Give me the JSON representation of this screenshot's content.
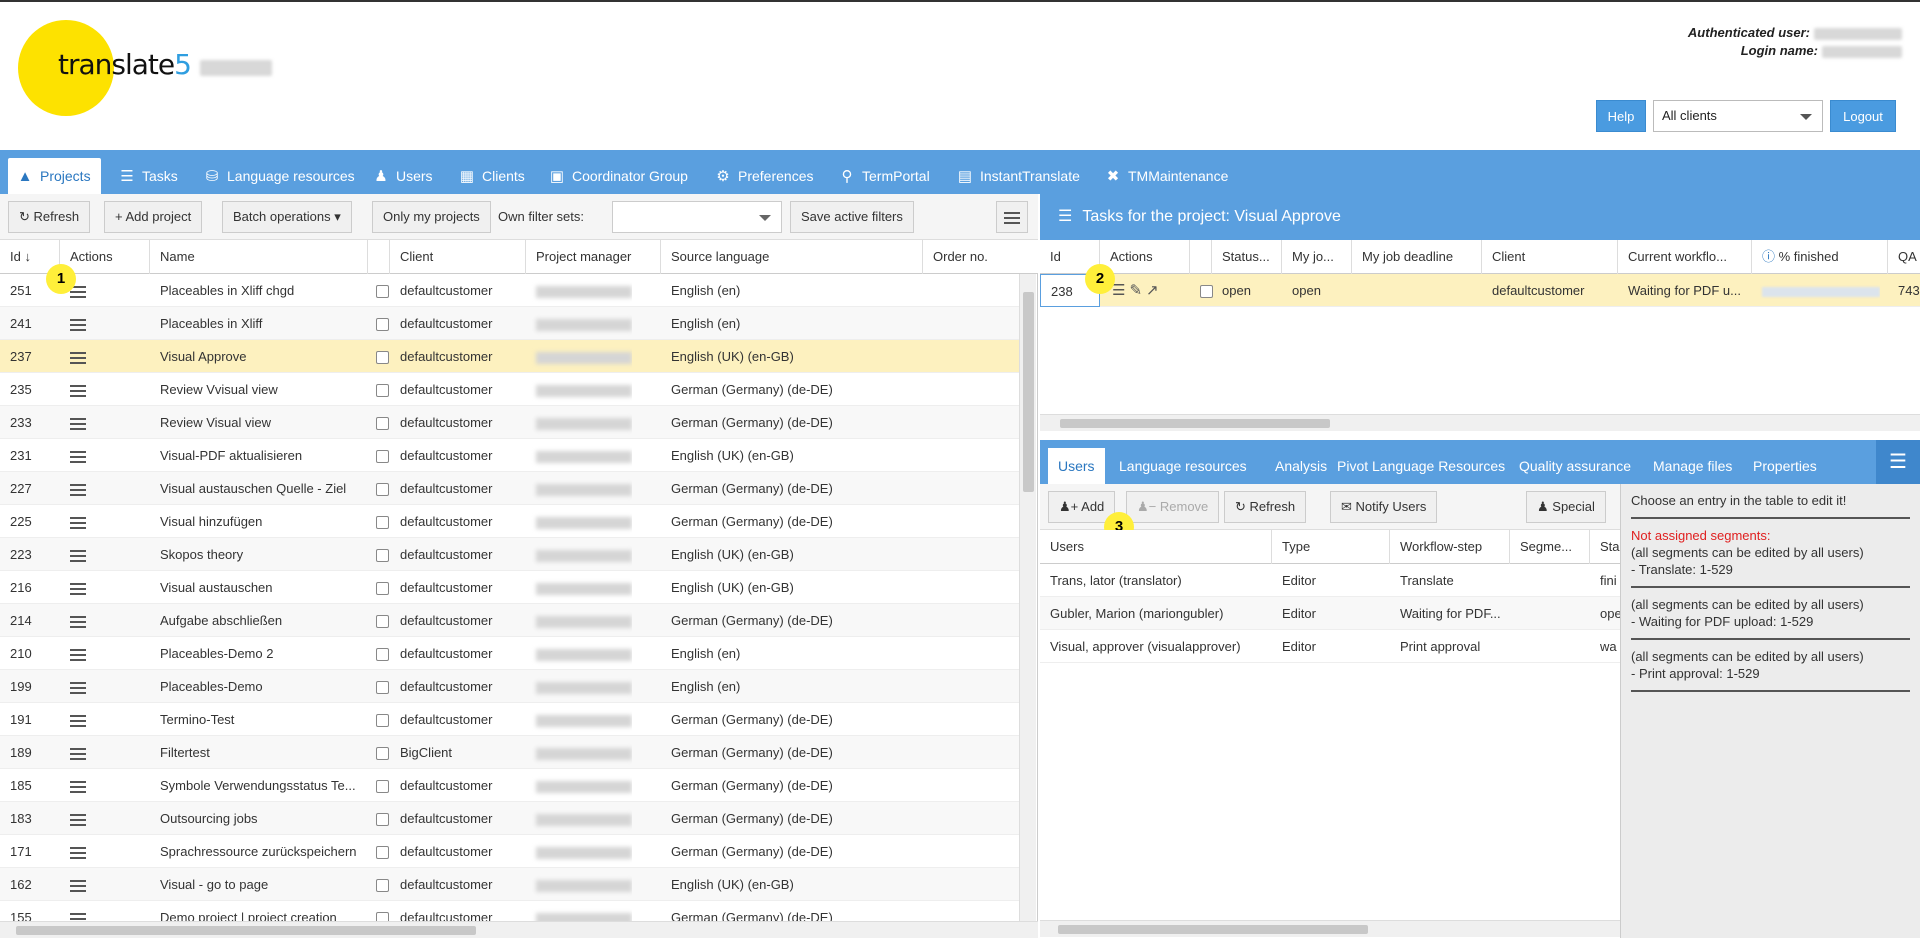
{
  "app": {
    "logo_text": "translate",
    "logo_five": "5"
  },
  "header": {
    "auth_user_label": "Authenticated user:",
    "login_name_label": "Login name:",
    "help_label": "Help",
    "client_select_value": "All clients",
    "logout_label": "Logout"
  },
  "nav": {
    "tabs": [
      {
        "label": "Projects",
        "icon": "sitemap-icon"
      },
      {
        "label": "Tasks",
        "icon": "list-icon"
      },
      {
        "label": "Language resources",
        "icon": "database-icon"
      },
      {
        "label": "Users",
        "icon": "users-icon"
      },
      {
        "label": "Clients",
        "icon": "building-icon"
      },
      {
        "label": "Coordinator Group",
        "icon": "id-badge-icon"
      },
      {
        "label": "Preferences",
        "icon": "gears-icon"
      },
      {
        "label": "TermPortal",
        "icon": "search-icon"
      },
      {
        "label": "InstantTranslate",
        "icon": "translate-icon"
      },
      {
        "label": "TMMaintenance",
        "icon": "tools-icon"
      }
    ]
  },
  "projects": {
    "toolbar": {
      "refresh": "Refresh",
      "add_project": "Add project",
      "batch_operations": "Batch operations",
      "only_my_projects": "Only my projects",
      "own_filter_sets": "Own filter sets:",
      "save_active_filters": "Save active filters"
    },
    "columns": [
      "Id",
      "Actions",
      "Name",
      "",
      "Client",
      "Project manager",
      "Source language",
      "Order no."
    ],
    "rows": [
      {
        "id": "251",
        "name": "Placeables in Xliff chgd",
        "client": "defaultcustomer",
        "lang": "English (en)"
      },
      {
        "id": "241",
        "name": "Placeables in Xliff",
        "client": "defaultcustomer",
        "lang": "English (en)"
      },
      {
        "id": "237",
        "name": "Visual Approve",
        "client": "defaultcustomer",
        "lang": "English (UK) (en-GB)"
      },
      {
        "id": "235",
        "name": "Review Vvisual view",
        "client": "defaultcustomer",
        "lang": "German (Germany) (de-DE)"
      },
      {
        "id": "233",
        "name": "Review Visual view",
        "client": "defaultcustomer",
        "lang": "German (Germany) (de-DE)"
      },
      {
        "id": "231",
        "name": "Visual-PDF aktualisieren",
        "client": "defaultcustomer",
        "lang": "English (UK) (en-GB)"
      },
      {
        "id": "227",
        "name": "Visual austauschen Quelle - Ziel",
        "client": "defaultcustomer",
        "lang": "German (Germany) (de-DE)"
      },
      {
        "id": "225",
        "name": "Visual hinzufügen",
        "client": "defaultcustomer",
        "lang": "German (Germany) (de-DE)"
      },
      {
        "id": "223",
        "name": "Skopos theory",
        "client": "defaultcustomer",
        "lang": "English (UK) (en-GB)"
      },
      {
        "id": "216",
        "name": "Visual austauschen",
        "client": "defaultcustomer",
        "lang": "English (UK) (en-GB)"
      },
      {
        "id": "214",
        "name": "Aufgabe abschließen",
        "client": "defaultcustomer",
        "lang": "German (Germany) (de-DE)"
      },
      {
        "id": "210",
        "name": "Placeables-Demo 2",
        "client": "defaultcustomer",
        "lang": "English (en)"
      },
      {
        "id": "199",
        "name": "Placeables-Demo",
        "client": "defaultcustomer",
        "lang": "English (en)"
      },
      {
        "id": "191",
        "name": "Termino-Test",
        "client": "defaultcustomer",
        "lang": "German (Germany) (de-DE)"
      },
      {
        "id": "189",
        "name": "Filtertest",
        "client": "BigClient",
        "lang": "German (Germany) (de-DE)"
      },
      {
        "id": "185",
        "name": "Symbole Verwendungsstatus Te...",
        "client": "defaultcustomer",
        "lang": "German (Germany) (de-DE)"
      },
      {
        "id": "183",
        "name": "Outsourcing jobs",
        "client": "defaultcustomer",
        "lang": "German (Germany) (de-DE)"
      },
      {
        "id": "171",
        "name": "Sprachressource zurückspeichern",
        "client": "defaultcustomer",
        "lang": "German (Germany) (de-DE)"
      },
      {
        "id": "162",
        "name": "Visual - go to page",
        "client": "defaultcustomer",
        "lang": "English (UK) (en-GB)"
      },
      {
        "id": "155",
        "name": "Demo project | project creation",
        "client": "defaultcustomer",
        "lang": "German (Germany) (de-DE)"
      }
    ],
    "marker": "1"
  },
  "tasks": {
    "title": "Tasks for the project: Visual Approve",
    "columns": [
      "Id",
      "Actions",
      "",
      "Status...",
      "My jo...",
      "My job deadline",
      "Client",
      "Current workflo...",
      "% finished",
      "QA"
    ],
    "row": {
      "id": "238",
      "status": "open",
      "my_job": "open",
      "client": "defaultcustomer",
      "workflow": "Waiting for PDF u...",
      "qa": "743"
    },
    "marker": "2"
  },
  "detail": {
    "tabs": [
      "Users",
      "Language resources",
      "Analysis",
      "Pivot Language Resources",
      "Quality assurance",
      "Manage files",
      "Properties"
    ],
    "toolbar": {
      "add": "Add",
      "remove": "Remove",
      "refresh": "Refresh",
      "notify": "Notify Users",
      "special": "Special"
    },
    "marker": "3",
    "columns": [
      "Users",
      "Type",
      "Workflow-step",
      "Segme...",
      "Sta"
    ],
    "rows": [
      {
        "user": "Trans, lator (translator)",
        "type": "Editor",
        "step": "Translate",
        "state": "fini"
      },
      {
        "user": "Gubler, Marion (mariongubler)",
        "type": "Editor",
        "step": "Waiting for PDF...",
        "state": "ope"
      },
      {
        "user": "Visual, approver (visualapprover)",
        "type": "Editor",
        "step": "Print approval",
        "state": "wa"
      }
    ],
    "side": {
      "hint": "Choose an entry in the table to edit it!",
      "not_assigned": "Not assigned segments:",
      "blocks": [
        [
          "(all segments can be edited by all users)",
          "- Translate: 1-529"
        ],
        [
          "(all segments can be edited by all users)",
          "- Waiting for PDF upload: 1-529"
        ],
        [
          "(all segments can be edited by all users)",
          "- Print approval: 1-529"
        ]
      ]
    }
  },
  "colors": {
    "brand_blue": "#5a9fdf",
    "logo_yellow": "#fde200",
    "selected_row": "#fdf1bf",
    "marker": "#ffef3a",
    "warning_red": "#e02020"
  }
}
